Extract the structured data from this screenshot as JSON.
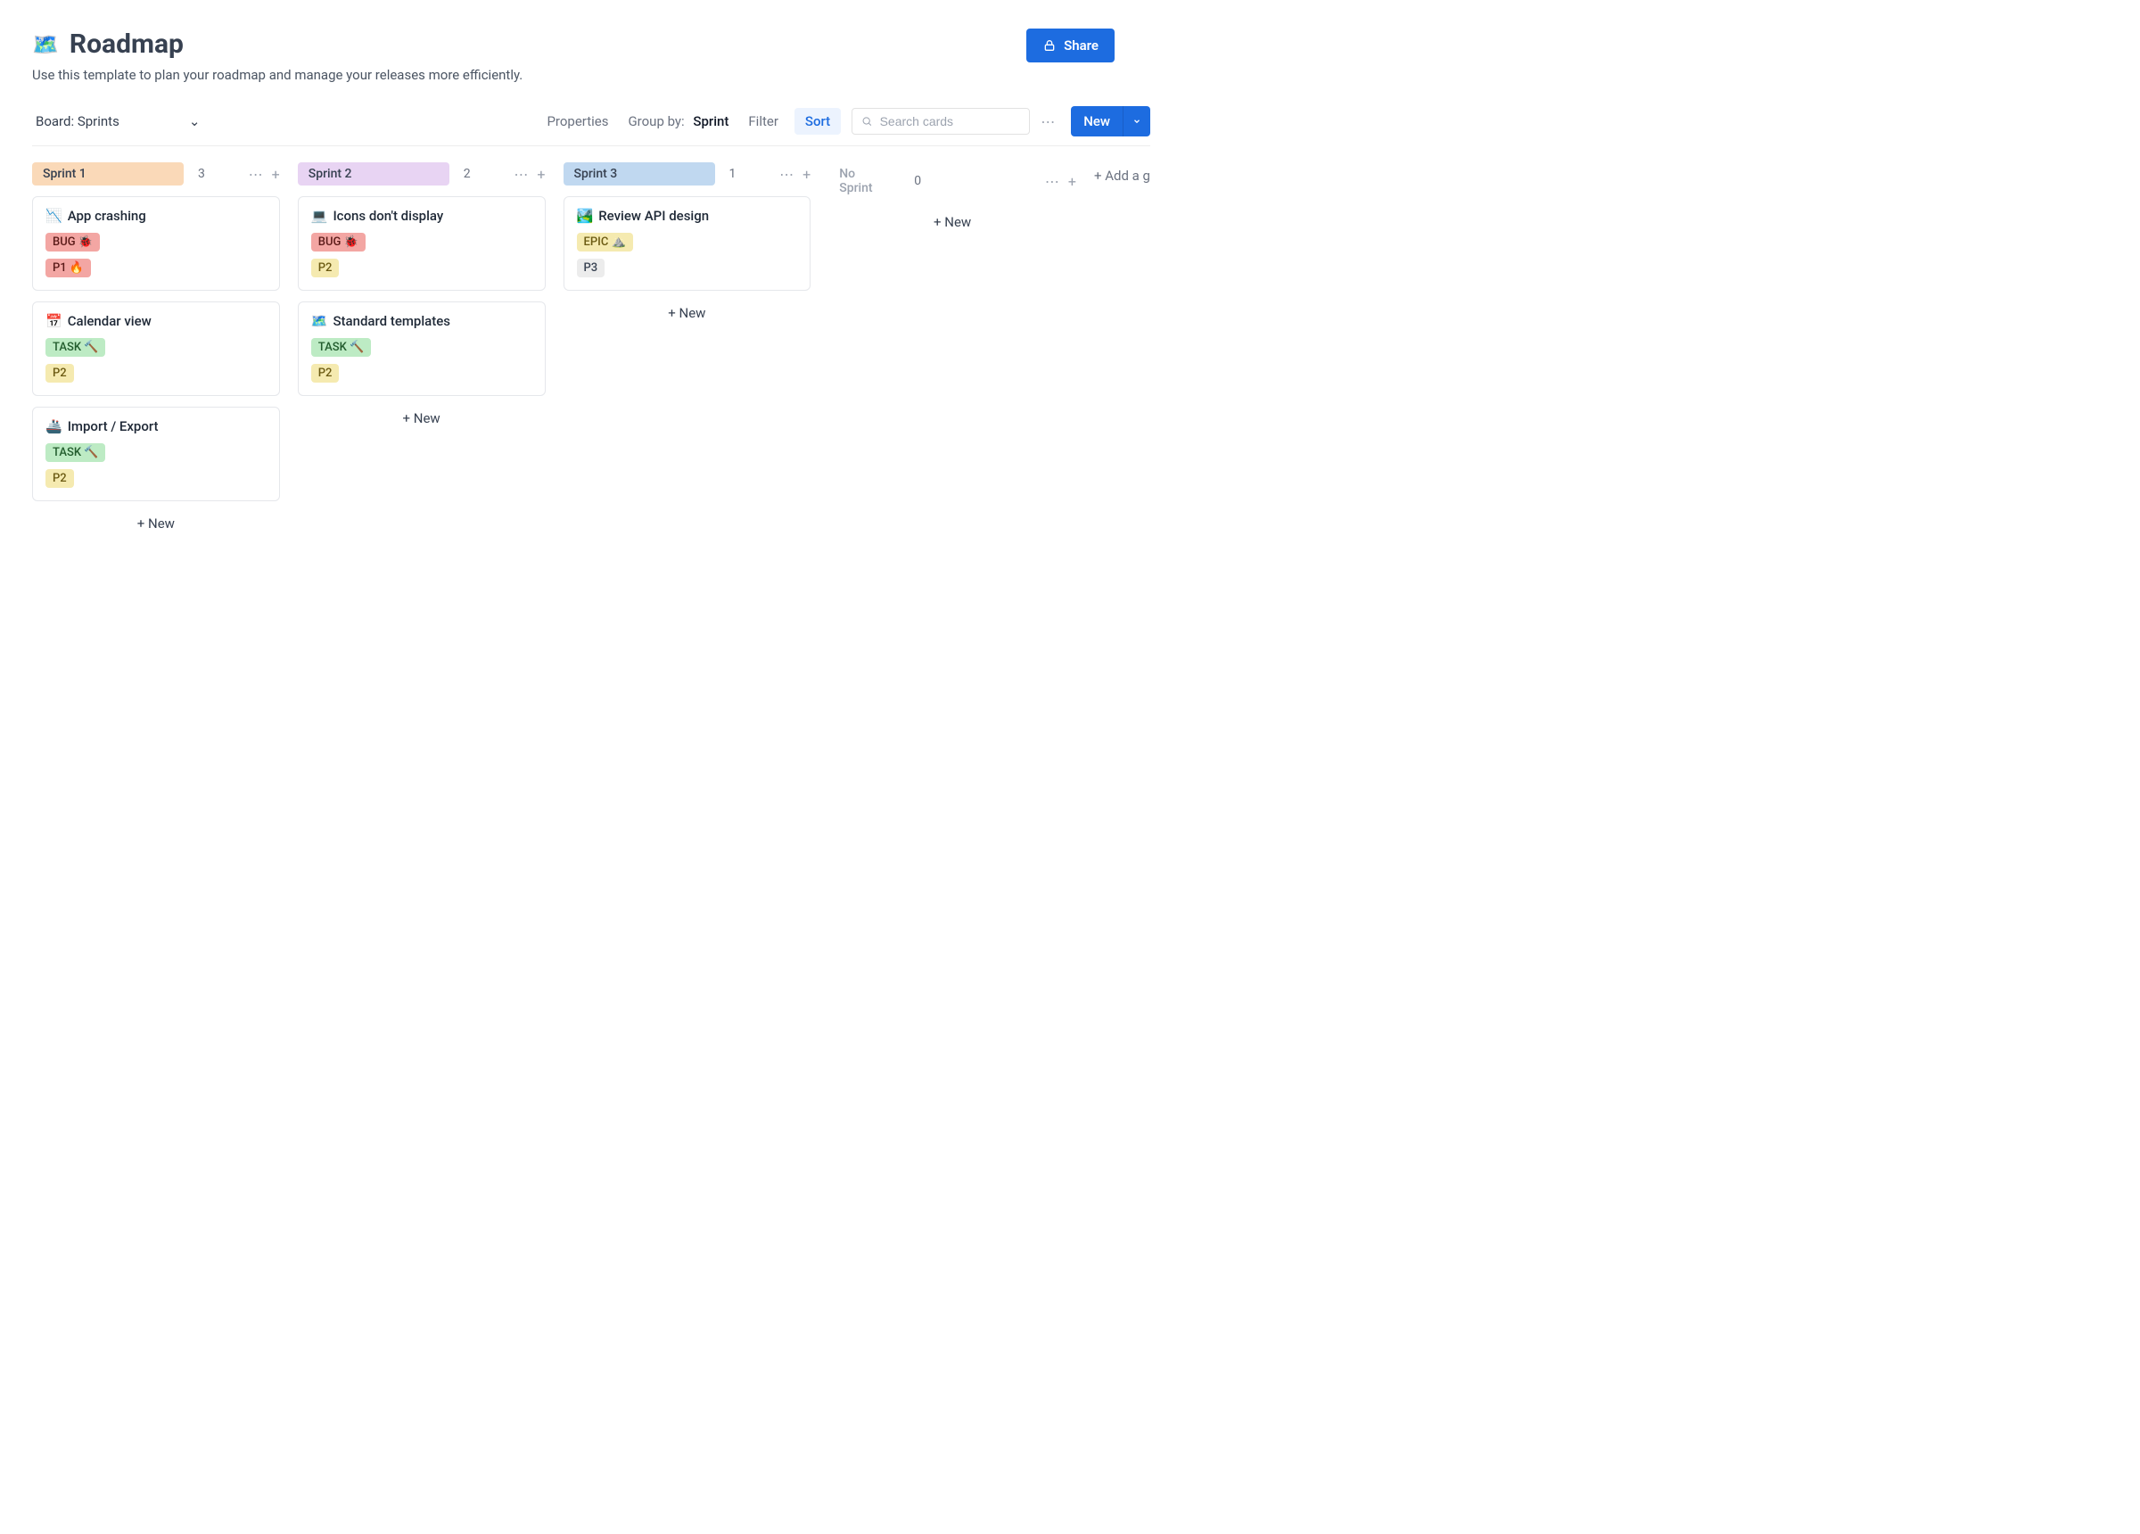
{
  "header": {
    "emoji": "🗺️",
    "title": "Roadmap",
    "subtitle": "Use this template to plan your roadmap and manage your releases more efficiently.",
    "share": "Share"
  },
  "toolbar": {
    "board_label": "Board: Sprints",
    "properties": "Properties",
    "group_by_label": "Group by:",
    "group_by_value": "Sprint",
    "filter": "Filter",
    "sort": "Sort",
    "search_placeholder": "Search cards",
    "new": "New"
  },
  "columns": [
    {
      "name": "Sprint 1",
      "count": "3",
      "pill_class": "pill-orange",
      "cards": [
        {
          "icon": "📉",
          "title": "App crashing",
          "tags": [
            {
              "text": "BUG 🐞",
              "style": "tag-bug"
            },
            {
              "text": "P1 🔥",
              "style": "tag-p1"
            }
          ]
        },
        {
          "icon": "📅",
          "title": "Calendar view",
          "tags": [
            {
              "text": "TASK 🔨",
              "style": "tag-task"
            },
            {
              "text": "P2",
              "style": "tag-p2"
            }
          ]
        },
        {
          "icon": "🚢",
          "title": "Import / Export",
          "tags": [
            {
              "text": "TASK 🔨",
              "style": "tag-task"
            },
            {
              "text": "P2",
              "style": "tag-p2"
            }
          ]
        }
      ]
    },
    {
      "name": "Sprint 2",
      "count": "2",
      "pill_class": "pill-purple",
      "cards": [
        {
          "icon": "💻",
          "title": "Icons don't display",
          "tags": [
            {
              "text": "BUG 🐞",
              "style": "tag-bug"
            },
            {
              "text": "P2",
              "style": "tag-p2"
            }
          ]
        },
        {
          "icon": "🗺️",
          "title": "Standard templates",
          "tags": [
            {
              "text": "TASK 🔨",
              "style": "tag-task"
            },
            {
              "text": "P2",
              "style": "tag-p2"
            }
          ]
        }
      ]
    },
    {
      "name": "Sprint 3",
      "count": "1",
      "pill_class": "pill-blue",
      "cards": [
        {
          "icon": "🏞️",
          "title": "Review API design",
          "tags": [
            {
              "text": "EPIC ⛰️",
              "style": "tag-epic"
            },
            {
              "text": "P3",
              "style": "tag-p3"
            }
          ]
        }
      ]
    },
    {
      "name": "No Sprint",
      "count": "0",
      "pill_class": "pill-none",
      "cards": []
    }
  ],
  "labels": {
    "new_card": "+ New",
    "add_group": "+ Add a g"
  }
}
